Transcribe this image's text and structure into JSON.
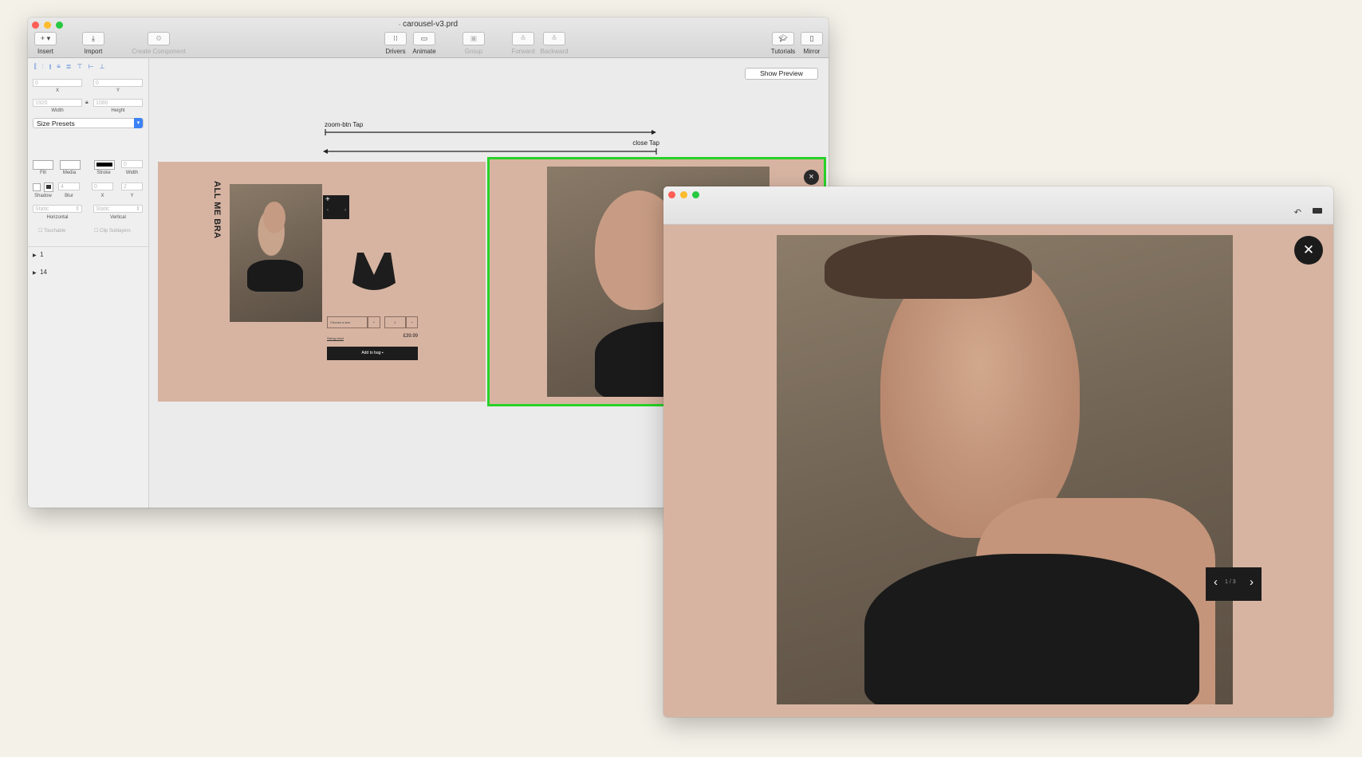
{
  "main_window": {
    "title": "carousel-v3.prd",
    "toolbar": {
      "insert": "Insert",
      "import": "Import",
      "create_component": "Create Component",
      "drivers": "Drivers",
      "animate": "Animate",
      "group": "Group",
      "forward": "Forward",
      "backward": "Backward",
      "tutorials": "Tutorials",
      "mirror": "Mirror"
    },
    "inspector": {
      "x_value": "0",
      "x_label": "X",
      "y_value": "0",
      "y_label": "Y",
      "width_value": "1920",
      "width_label": "Width",
      "height_value": "1080",
      "height_label": "Height",
      "size_presets": "Size Presets",
      "fill_label": "Fill",
      "media_label": "Media",
      "stroke_label": "Stroke",
      "stroke_width_label": "Width",
      "stroke_width_value": "0",
      "shadow_label": "Shadow",
      "blur_label": "Blur",
      "blur_value": "4",
      "shadow_x_label": "X",
      "shadow_x_value": "0",
      "shadow_y_label": "Y",
      "shadow_y_value": "2",
      "horizontal_value": "Static",
      "horizontal_label": "Horizontal",
      "vertical_value": "Static",
      "vertical_label": "Vertical",
      "touchable": "Touchable",
      "clip_sublayers": "Clip Sublayers"
    },
    "layers": [
      {
        "label": "1"
      },
      {
        "label": "14"
      }
    ],
    "canvas": {
      "show_preview": "Show Preview",
      "transition_forward": "zoom-btn Tap",
      "transition_back": "close Tap",
      "artboard1": {
        "heading": "ALL ME BRA",
        "size_select": "Choose a size",
        "qty": "1",
        "size_guide": "Sizing chart",
        "price": "£39.99",
        "add_to_bag": "Add to bag"
      }
    }
  },
  "preview_window": {
    "counter": "1 / 3"
  },
  "colors": {
    "selection": "#28d228",
    "artboard_bg": "#d7b4a2",
    "dark": "#1c1c1c",
    "accent_blue": "#3b82f6"
  }
}
